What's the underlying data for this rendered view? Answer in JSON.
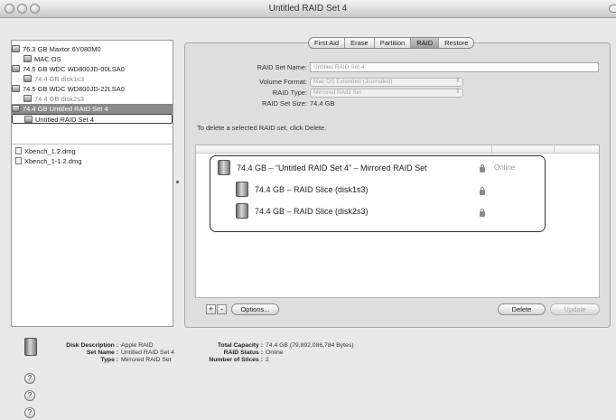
{
  "window": {
    "title": "Untitled RAID Set 4"
  },
  "sidebar": {
    "volumes": [
      {
        "label": "76.3 GB Maxtor 6Y080M0",
        "indent": false,
        "state": "normal"
      },
      {
        "label": "MAC OS",
        "indent": true,
        "state": "normal"
      },
      {
        "label": "74.5 GB WDC WD800JD-00LSA0",
        "indent": false,
        "state": "normal"
      },
      {
        "label": "74.4 GB disk1s3",
        "indent": true,
        "state": "disabled"
      },
      {
        "label": "74.5 GB WDC WD800JD-22LSA0",
        "indent": false,
        "state": "normal"
      },
      {
        "label": "74.4 GB disk2s3",
        "indent": true,
        "state": "disabled"
      },
      {
        "label": "74.4 GB Untitled RAID Set 4",
        "indent": false,
        "state": "selected"
      },
      {
        "label": "Untitled RAID Set 4",
        "indent": true,
        "state": "outlined"
      }
    ],
    "images": [
      {
        "label": "Xbench_1.2.dmg"
      },
      {
        "label": "Xbench_1-1.2.dmg"
      }
    ]
  },
  "tabs": [
    {
      "label": "First Aid",
      "active": false
    },
    {
      "label": "Erase",
      "active": false
    },
    {
      "label": "Partition",
      "active": false
    },
    {
      "label": "RAID",
      "active": true
    },
    {
      "label": "Restore",
      "active": false
    }
  ],
  "form": {
    "set_name_label": "RAID Set Name:",
    "set_name_value": "Untitled RAID Set 4",
    "volume_format_label": "Volume Format:",
    "volume_format_value": "Mac OS Extended (Journaled)",
    "raid_type_label": "RAID Type:",
    "raid_type_value": "Mirrored RAID Set",
    "set_size_label": "RAID Set Size:",
    "set_size_value": "74.4 GB",
    "delete_hint": "To delete a selected RAID set, click Delete."
  },
  "raid_table": {
    "rows": [
      {
        "label": "74.4 GB – “Untitled RAID Set 4” – Mirrored RAID Set",
        "status": "Online",
        "level": 0
      },
      {
        "label": "74.4 GB – RAID Slice (disk1s3)",
        "status": "",
        "level": 1
      },
      {
        "label": "74.4 GB – RAID Slice (disk2s3)",
        "status": "",
        "level": 1
      }
    ]
  },
  "buttons": {
    "add": "+",
    "remove": "-",
    "options": "Options...",
    "delete": "Delete",
    "update": "Update"
  },
  "info": {
    "disk_description_label": "Disk Description :",
    "disk_description_value": "Apple RAID",
    "set_name_label": "Set Name :",
    "set_name_value": "Untitled RAID Set 4",
    "type_label": "Type :",
    "type_value": "Mirrored RAID Set",
    "total_capacity_label": "Total Capacity :",
    "total_capacity_value": "74.4 GB (79,892,086,784 Bytes)",
    "raid_status_label": "RAID Status :",
    "raid_status_value": "Online",
    "slices_label": "Number of Slices :",
    "slices_value": "2"
  },
  "help": {
    "button_1": "?",
    "button_2": "?",
    "button_3": "?"
  }
}
